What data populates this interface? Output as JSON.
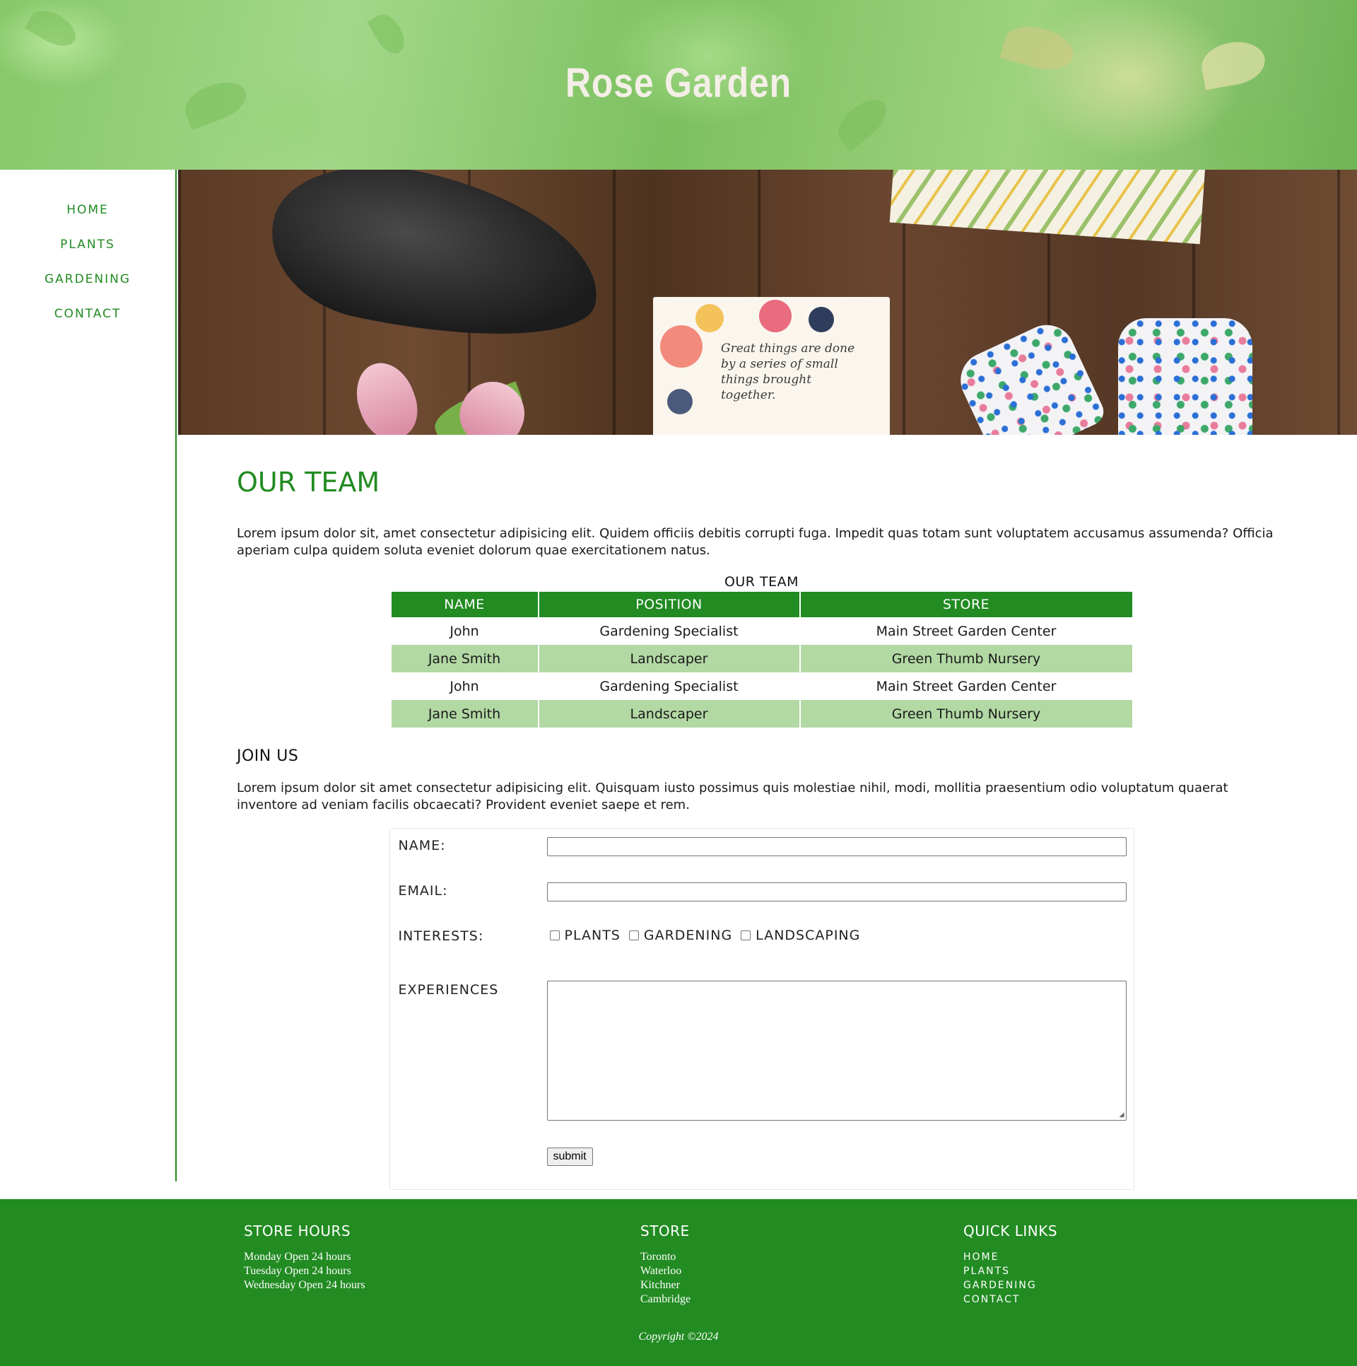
{
  "header": {
    "title": "Rose Garden"
  },
  "nav": [
    "HOME",
    "PLANTS",
    "GARDENING",
    "CONTACT"
  ],
  "hero": {
    "card_text": "Great things are done by a series of small things brought together."
  },
  "main": {
    "heading": "OUR TEAM",
    "intro": "Lorem ipsum dolor sit, amet consectetur adipisicing elit. Quidem officiis debitis corrupti fuga. Impedit quas totam sunt voluptatem accusamus assumenda? Officia aperiam culpa quidem soluta eveniet dolorum quae exercitationem natus.",
    "table": {
      "caption": "OUR TEAM",
      "headers": [
        "NAME",
        "POSITION",
        "STORE"
      ],
      "rows": [
        [
          "John",
          "Gardening Specialist",
          "Main Street Garden Center"
        ],
        [
          "Jane Smith",
          "Landscaper",
          "Green Thumb Nursery"
        ],
        [
          "John",
          "Gardening Specialist",
          "Main Street Garden Center"
        ],
        [
          "Jane Smith",
          "Landscaper",
          "Green Thumb Nursery"
        ]
      ]
    },
    "join": {
      "heading": "JOIN US",
      "text": "Lorem ipsum dolor sit amet consectetur adipisicing elit. Quisquam iusto possimus quis molestiae nihil, modi, mollitia praesentium odio voluptatum quaerat inventore ad veniam facilis obcaecati? Provident eveniet saepe et rem."
    },
    "form": {
      "name_label": "NAME:",
      "name_value": "",
      "email_label": "EMAIL:",
      "email_value": "",
      "interests_label": "INTERESTS:",
      "interests": [
        "PLANTS",
        "GARDENING",
        "LANDSCAPING"
      ],
      "experiences_label": "EXPERIENCES",
      "experiences_value": "",
      "submit_label": "submit"
    }
  },
  "footer": {
    "hours": {
      "heading": "STORE HOURS",
      "lines": [
        "Monday Open 24 hours",
        "Tuesday Open 24 hours",
        "Wednesday Open 24 hours"
      ]
    },
    "store": {
      "heading": "STORE",
      "lines": [
        "Toronto",
        "Waterloo",
        "Kitchner",
        "Cambridge"
      ]
    },
    "links": {
      "heading": "QUICK LINKS",
      "items": [
        "HOME",
        "PLANTS",
        "GARDENING",
        "CONTACT"
      ]
    },
    "copyright": "Copyright ©2024"
  },
  "colors": {
    "brand": "#228b22",
    "row_alt": "#b2d8a4",
    "title_text": "#f4efe6"
  },
  "icons": [
    "resize-grip-icon"
  ]
}
